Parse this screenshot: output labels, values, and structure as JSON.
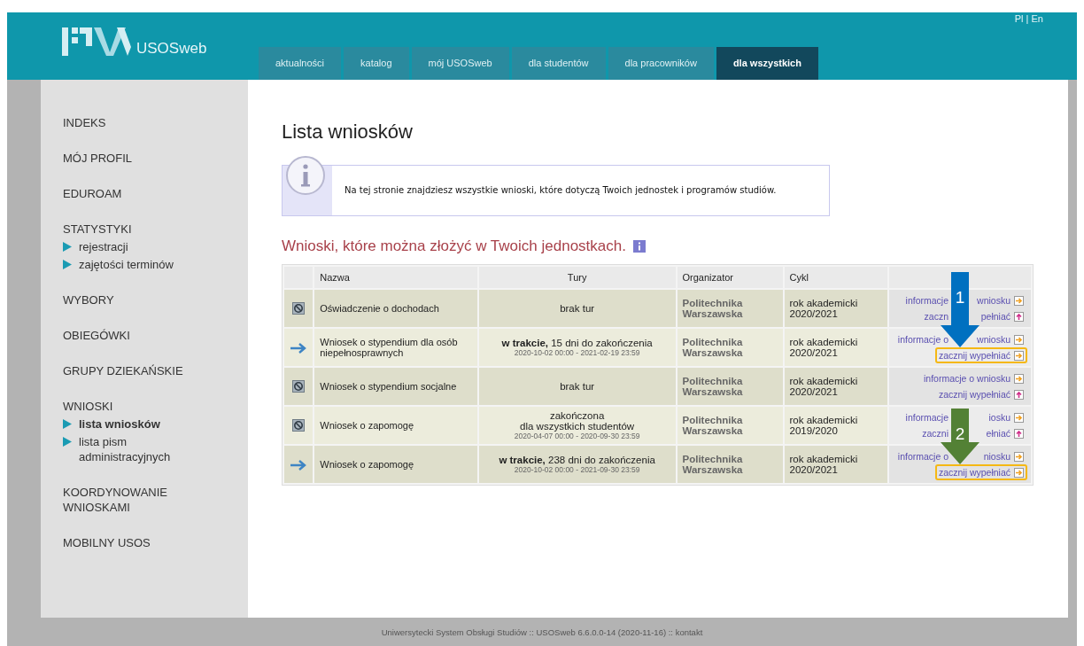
{
  "header": {
    "brand": "USOSweb",
    "language_links": "Pl | En",
    "tabs": [
      {
        "label": "aktualności",
        "selected": false
      },
      {
        "label": "katalog",
        "selected": false
      },
      {
        "label": "mój USOSweb",
        "selected": false
      },
      {
        "label": "dla studentów",
        "selected": false
      },
      {
        "label": "dla pracowników",
        "selected": false
      },
      {
        "label": "dla wszystkich",
        "selected": true
      }
    ]
  },
  "sidebar": {
    "sections": [
      {
        "label": "INDEKS"
      },
      {
        "label": "MÓJ PROFIL"
      },
      {
        "label": "EDUROAM"
      },
      {
        "label": "STATYSTYKI",
        "children": [
          {
            "label": "rejestracji",
            "selected": false
          },
          {
            "label": "zajętości terminów",
            "selected": false
          }
        ]
      },
      {
        "label": "WYBORY"
      },
      {
        "label": "OBIEGÓWKI"
      },
      {
        "label": "GRUPY DZIEKAŃSKIE"
      },
      {
        "label": "WNIOSKI",
        "children": [
          {
            "label": "lista wniosków",
            "selected": true
          },
          {
            "label": "lista pism administracyjnych",
            "selected": false
          }
        ]
      },
      {
        "label": "KOORDYNOWANIE WNIOSKAMI"
      },
      {
        "label": "MOBILNY USOS"
      }
    ]
  },
  "page": {
    "title": "Lista wniosków",
    "info_note": "Na tej stronie znajdziesz wszystkie wnioski, które dotyczą Twoich jednostek i programów studiów.",
    "section_heading": "Wnioski, które można złożyć w Twoich jednostkach.",
    "table": {
      "columns": [
        "Nazwa",
        "Tury",
        "Organizator",
        "Cykl"
      ],
      "rows": [
        {
          "kind": "closed",
          "name": "Oświadczenie o dochodach",
          "rounds": [
            {
              "kind": "main",
              "text": "brak tur"
            }
          ],
          "organizer": "Politechnika Warszawska",
          "cycle": "rok akademicki 2020/2021",
          "info_link": {
            "parts": [
              "informacje",
              "wniosku"
            ]
          },
          "start_link": {
            "parts": [
              "zaczn",
              "pełniać"
            ],
            "available": false,
            "highlighted": false
          },
          "annotation": {
            "number": "1",
            "color": "#0070c0"
          }
        },
        {
          "kind": "open",
          "name": "Wniosek o stypendium dla osób niepełnosprawnych",
          "rounds": [
            {
              "kind": "main",
              "text": "**w trakcie,** 15 dni do zakończenia"
            },
            {
              "kind": "date",
              "text": "2020-10-02 00:00 - 2021-02-19 23:59"
            }
          ],
          "organizer": "Politechnika Warszawska",
          "cycle": "rok akademicki 2020/2021",
          "info_link": {
            "parts": [
              "informacje o",
              "wniosku"
            ]
          },
          "start_link": {
            "parts": [
              "zacznij wypełniać"
            ],
            "available": true,
            "highlighted": true
          }
        },
        {
          "kind": "closed",
          "name": "Wniosek o stypendium socjalne",
          "rounds": [
            {
              "kind": "main",
              "text": "brak tur"
            }
          ],
          "organizer": "Politechnika Warszawska",
          "cycle": "rok akademicki 2020/2021",
          "info_link": {
            "parts": [
              "informacje o wniosku"
            ]
          },
          "start_link": {
            "parts": [
              "zacznij wypełniać"
            ],
            "available": false,
            "highlighted": false
          }
        },
        {
          "kind": "closed",
          "name": "Wniosek o zapomogę",
          "rounds": [
            {
              "kind": "main",
              "text": "zakończona"
            },
            {
              "kind": "main",
              "text": "dla wszystkich studentów"
            },
            {
              "kind": "date",
              "text": "2020-04-07 00:00 - 2020-09-30 23:59"
            }
          ],
          "organizer": "Politechnika Warszawska",
          "cycle": "rok akademicki 2019/2020",
          "info_link": {
            "parts": [
              "informacje",
              "iosku"
            ]
          },
          "start_link": {
            "parts": [
              "zaczni",
              "ełniać"
            ],
            "available": false,
            "highlighted": false
          },
          "annotation": {
            "number": "2",
            "color": "#538135"
          }
        },
        {
          "kind": "open",
          "name": "Wniosek o zapomogę",
          "rounds": [
            {
              "kind": "main",
              "text": "**w trakcie,** 238 dni do zakończenia"
            },
            {
              "kind": "date",
              "text": "2020-10-02 00:00 - 2021-09-30 23:59"
            }
          ],
          "organizer": "Politechnika Warszawska",
          "cycle": "rok akademicki 2020/2021",
          "info_link": {
            "parts": [
              "informacje o",
              "niosku"
            ]
          },
          "start_link": {
            "parts": [
              "zacznij wypełniać"
            ],
            "available": true,
            "highlighted": true
          }
        }
      ]
    }
  },
  "footer": {
    "text": "Uniwersytecki System Obsługi Studiów :: USOSweb 6.6.0.0-14 (2020-11-16) :: kontakt"
  }
}
